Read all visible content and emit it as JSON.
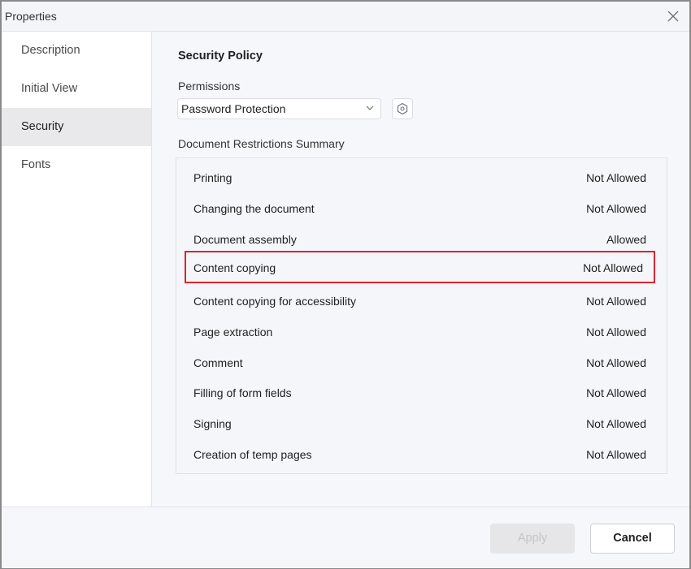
{
  "window": {
    "title": "Properties"
  },
  "sidebar": {
    "items": [
      {
        "label": "Description",
        "active": false
      },
      {
        "label": "Initial View",
        "active": false
      },
      {
        "label": "Security",
        "active": true
      },
      {
        "label": "Fonts",
        "active": false
      }
    ]
  },
  "security": {
    "section_title": "Security Policy",
    "permissions_label": "Permissions",
    "permissions_value": "Password Protection",
    "settings_icon": "hexagon-settings-icon",
    "summary_label": "Document Restrictions Summary",
    "restrictions": [
      {
        "name": "Printing",
        "value": "Not Allowed"
      },
      {
        "name": "Changing the document",
        "value": "Not Allowed"
      },
      {
        "name": "Document assembly",
        "value": "Allowed"
      },
      {
        "name": "Content copying",
        "value": "Not Allowed",
        "highlighted": true
      },
      {
        "name": "Content copying for accessibility",
        "value": "Not Allowed"
      },
      {
        "name": "Page extraction",
        "value": "Not Allowed"
      },
      {
        "name": "Comment",
        "value": "Not Allowed"
      },
      {
        "name": "Filling of form fields",
        "value": "Not Allowed"
      },
      {
        "name": "Signing",
        "value": "Not Allowed"
      },
      {
        "name": "Creation of temp pages",
        "value": "Not Allowed"
      }
    ],
    "highlight_color": "#d9252f"
  },
  "footer": {
    "apply_label": "Apply",
    "apply_disabled": true,
    "cancel_label": "Cancel"
  }
}
